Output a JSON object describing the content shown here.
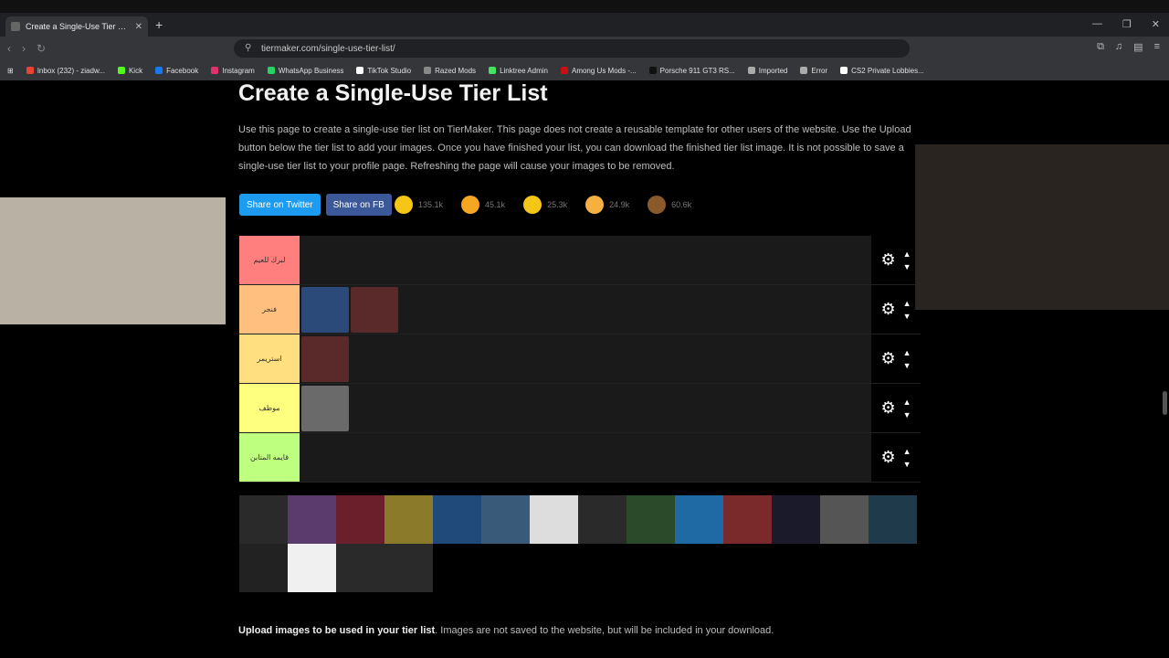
{
  "browser": {
    "tab_title": "Create a Single-Use Tier List (Fr",
    "url": "tiermaker.com/single-use-tier-list/",
    "bookmarks": [
      {
        "label": "Inbox (232) - ziadw...",
        "icon": "gmail-icon",
        "color": "#ea4335"
      },
      {
        "label": "Kick",
        "icon": "kick-icon",
        "color": "#53fc18"
      },
      {
        "label": "Facebook",
        "icon": "facebook-icon",
        "color": "#1877f2"
      },
      {
        "label": "Instagram",
        "icon": "instagram-icon",
        "color": "#e1306c"
      },
      {
        "label": "WhatsApp Business",
        "icon": "whatsapp-icon",
        "color": "#25d366"
      },
      {
        "label": "TikTok Studio",
        "icon": "tiktok-icon",
        "color": "#ffffff"
      },
      {
        "label": "Razed Mods",
        "icon": "razed-icon",
        "color": "#888888"
      },
      {
        "label": "Linktree Admin",
        "icon": "linktree-icon",
        "color": "#43e55e"
      },
      {
        "label": "Among Us Mods -...",
        "icon": "amongus-icon",
        "color": "#c51111"
      },
      {
        "label": "Porsche 911 GT3 RS...",
        "icon": "porsche-icon",
        "color": "#111111"
      },
      {
        "label": "Imported",
        "icon": "folder-icon",
        "color": "#aaaaaa"
      },
      {
        "label": "Error",
        "icon": "globe-icon",
        "color": "#aaaaaa"
      },
      {
        "label": "CS2 Private Lobbies...",
        "icon": "cs2-icon",
        "color": "#ffffff"
      }
    ]
  },
  "page": {
    "title": "Create a Single-Use Tier List",
    "description": "Use this page to create a single-use tier list on TierMaker. This page does not create a reusable template for other users of the website. Use the Upload button below the tier list to add your images. Once you have finished your list, you can download the finished tier list image. It is not possible to save a single-use tier list to your profile page. Refreshing the page will cause your images to be removed.",
    "share_twitter": "Share on Twitter",
    "share_fb": "Share on FB",
    "reactions": [
      {
        "count": "135.1k",
        "icon": "grin-emoji-icon",
        "color": "#f5c518"
      },
      {
        "count": "45.1k",
        "icon": "heart-eyes-emoji-icon",
        "color": "#f5a623"
      },
      {
        "count": "25.3k",
        "icon": "laugh-emoji-icon",
        "color": "#f5c518"
      },
      {
        "count": "24.9k",
        "icon": "raised-hands-emoji-icon",
        "color": "#f5b041"
      },
      {
        "count": "60.6k",
        "icon": "poop-emoji-icon",
        "color": "#8b5a2b"
      }
    ],
    "tiers": [
      {
        "label": "لبرك للعيم",
        "color": "#ff7f7f",
        "thumbs": 0
      },
      {
        "label": "فنجر",
        "color": "#ffbf7f",
        "thumbs": 2
      },
      {
        "label": "استريمر",
        "color": "#ffdf7f",
        "thumbs": 1
      },
      {
        "label": "موظف",
        "color": "#ffff7f",
        "thumbs": 1
      },
      {
        "label": "قايمه المتابن",
        "color": "#bfff7f",
        "thumbs": 0
      }
    ],
    "pool_count": 18,
    "upload_bold": "Upload images to be used in your tier list",
    "upload_rest": ". Images are not saved to the website, but will be included in your download."
  }
}
